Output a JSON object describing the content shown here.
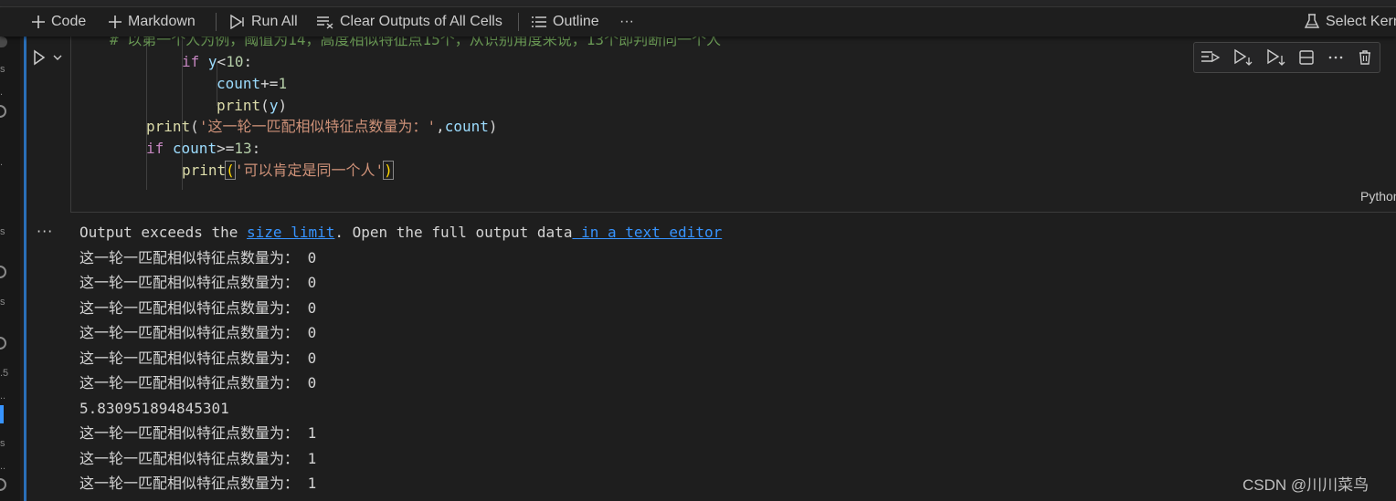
{
  "toolbar": {
    "code_label": "Code",
    "markdown_label": "Markdown",
    "run_all_label": "Run All",
    "clear_outputs_label": "Clear Outputs of All Cells",
    "outline_label": "Outline",
    "more_label": "···",
    "select_kernel_label": "Select Kern"
  },
  "cell": {
    "language": "Python",
    "code": {
      "comment": "# 以第一个人为例，阈值为14，高度相似特征点15个，从识别角度来说，13个即判断同一个人",
      "l1_kw": "if",
      "l1_var": "y",
      "l1_op": "<",
      "l1_num": "10",
      "l1_colon": ":",
      "l2_var": "count",
      "l2_op": "+=",
      "l2_num": "1",
      "l3_fn": "print",
      "l3_open": "(",
      "l3_var": "y",
      "l3_close": ")",
      "l4_fn": "print",
      "l4_open": "(",
      "l4_str": "'这一轮一匹配相似特征点数量为：'",
      "l4_comma": ",",
      "l4_var": "count",
      "l4_close": ")",
      "l5_kw": "if",
      "l5_var": "count",
      "l5_op": ">=",
      "l5_num": "13",
      "l5_colon": ":",
      "l6_fn": "print",
      "l6_open": "(",
      "l6_str": "'可以肯定是同一个人'",
      "l6_close": ")"
    }
  },
  "output": {
    "more_label": "···",
    "notice_prefix": "Output exceeds the ",
    "notice_link1": "size limit",
    "notice_middle": ". Open the full output data",
    "notice_link2": " in a text editor",
    "lines": [
      "这一轮一匹配相似特征点数量为： 0",
      "这一轮一匹配相似特征点数量为： 0",
      "这一轮一匹配相似特征点数量为： 0",
      "这一轮一匹配相似特征点数量为： 0",
      "这一轮一匹配相似特征点数量为： 0",
      "这一轮一匹配相似特征点数量为： 0",
      "5.830951894845301",
      "这一轮一匹配相似特征点数量为： 1",
      "这一轮一匹配相似特征点数量为： 1",
      "这一轮一匹配相似特征点数量为： 1"
    ]
  },
  "sidebar_fragments": [
    "s",
    ".",
    "s",
    "s",
    ".5",
    "..",
    "s",
    ".."
  ],
  "watermark": "CSDN @川川菜鸟",
  "colors": {
    "keyword": "#c586c0",
    "variable": "#9cdcfe",
    "function": "#dcdcaa",
    "string": "#ce9178",
    "number": "#b5cea8",
    "comment": "#6a9955",
    "link": "#3794ff",
    "cell_focus_border": "#2a6fb8"
  }
}
